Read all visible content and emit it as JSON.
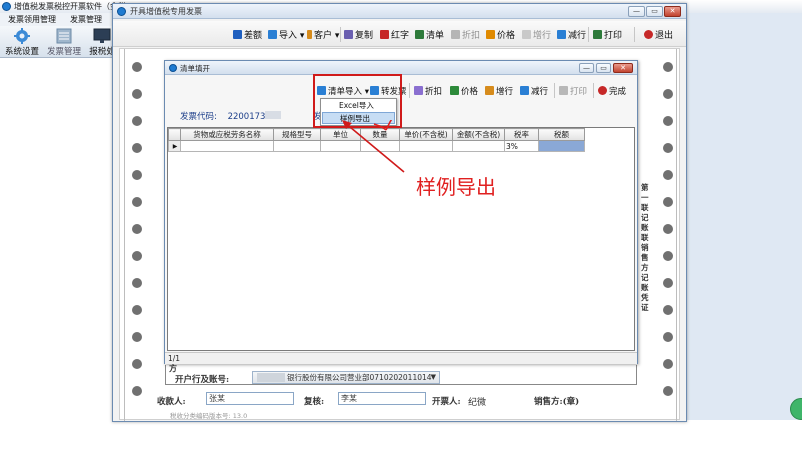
{
  "background_app": {
    "title": "增值税发票税控开票软件（金税",
    "menu": [
      "发票领用管理",
      "发票管理"
    ],
    "toolbar": [
      {
        "label": "系统设置",
        "icon": "gear-icon"
      },
      {
        "label": "发票管理",
        "icon": "invoice-icon"
      },
      {
        "label": "报税处",
        "icon": "monitor-icon"
      }
    ]
  },
  "invoice_window": {
    "title": "开具增值税专用发票",
    "window_buttons": {
      "minimize": "—",
      "restore": "▭",
      "close": "✕"
    },
    "toolbar": [
      {
        "label": "差额",
        "icon": "diff-icon",
        "color": "#1f5fbf",
        "enabled": true
      },
      {
        "label": "导入",
        "icon": "import-icon",
        "color": "#2a7fd4",
        "enabled": true,
        "dropdown": true
      },
      {
        "label": "客户",
        "icon": "customer-icon",
        "color": "#d68b1c",
        "enabled": true,
        "dropdown": true
      },
      {
        "label": "复制",
        "icon": "copy-icon",
        "color": "#6a5fb0",
        "enabled": true
      },
      {
        "label": "红字",
        "icon": "red-invoice-icon",
        "color": "#c62828",
        "enabled": true
      },
      {
        "label": "清单",
        "icon": "list-icon",
        "color": "#2d7a3a",
        "enabled": true
      },
      {
        "label": "折扣",
        "icon": "discount-icon",
        "color": "#9a9a9a",
        "enabled": false
      },
      {
        "label": "价格",
        "icon": "price-icon",
        "color": "#e08a00",
        "enabled": true
      },
      {
        "label": "增行",
        "icon": "add-row-icon",
        "color": "#9a9a9a",
        "enabled": false
      },
      {
        "label": "减行",
        "icon": "remove-row-icon",
        "color": "#2a7fd4",
        "enabled": true
      },
      {
        "label": "打印",
        "icon": "print-icon",
        "color": "#2d7a3a",
        "enabled": true
      },
      {
        "label": "退出",
        "icon": "exit-icon",
        "color": "#c62828",
        "enabled": true
      }
    ],
    "paper": {
      "side_text": "第一联记账联销售方记账凭证",
      "segment_label": "方",
      "bank_label": "开户行及账号:",
      "bank_value": "银行股份有限公司营业部0710202011014",
      "payee_label": "收款人:",
      "payee_value": "张某",
      "reviewer_label": "复核:",
      "reviewer_value": "李某",
      "drawer_label": "开票人:",
      "drawer_value": "纪微",
      "seller_label": "销售方:(章)",
      "tax_version": "税收分类编码版本号: 13.0"
    }
  },
  "list_dialog": {
    "title": "清单填开",
    "window_buttons": {
      "minimize": "—",
      "restore": "▭",
      "close": "✕"
    },
    "toolbar": [
      {
        "label": "清单导入",
        "icon": "list-import-icon",
        "color": "#2a7fd4",
        "enabled": true,
        "dropdown": true
      },
      {
        "label": "转发票",
        "icon": "convert-icon",
        "color": "#2a7fd4",
        "enabled": true
      },
      {
        "label": "折扣",
        "icon": "discount-icon",
        "color": "#8a6fd0",
        "enabled": true
      },
      {
        "label": "价格",
        "icon": "price-icon",
        "color": "#2d8a3a",
        "enabled": true
      },
      {
        "label": "增行",
        "icon": "add-row-icon",
        "color": "#d68b1c",
        "enabled": true
      },
      {
        "label": "减行",
        "icon": "remove-row-icon",
        "color": "#2a7fd4",
        "enabled": true
      },
      {
        "label": "打印",
        "icon": "print-icon",
        "color": "#9a9a9a",
        "enabled": false
      },
      {
        "label": "完成",
        "icon": "finish-icon",
        "color": "#c62828",
        "enabled": true
      }
    ],
    "invoice_code_label": "发票代码:",
    "invoice_code_value": "2200173",
    "invoice_code_2_label": "发",
    "grid": {
      "columns": [
        "货物或应税劳务名称",
        "规格型号",
        "单位",
        "数量",
        "单价(不含税)",
        "金额(不含税)",
        "税率",
        "税额"
      ],
      "rows": [
        {
          "marker": "▶",
          "cells": [
            "",
            "",
            "",
            "",
            "",
            "",
            "3%",
            ""
          ]
        }
      ]
    },
    "status": "1/1"
  },
  "dropdown_menu": {
    "items": [
      {
        "label": "Excel导入",
        "selected": false
      },
      {
        "label": "样例导出",
        "selected": true
      }
    ]
  },
  "annotation": {
    "text": "样例导出",
    "check_mark": "√",
    "color": "#e02020"
  }
}
